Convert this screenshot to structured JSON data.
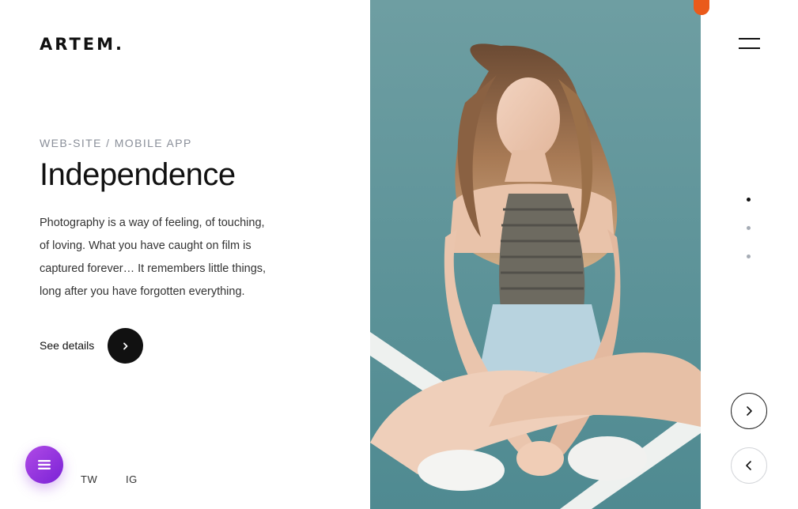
{
  "brand": {
    "logo_text": "ARTEM."
  },
  "project": {
    "category": "WEB-SITE / MOBILE APP",
    "title": "Independence",
    "description": "Photography is a way of feeling, of touching, of loving. What you have caught on film is captured forever… It remembers little things, long after you have forgotten everything.",
    "details_label": "See details"
  },
  "social": {
    "links": [
      "TW",
      "IG"
    ]
  },
  "slider": {
    "total_slides": 3,
    "active_index": 0
  },
  "icons": {
    "details": "chevron-right-icon",
    "menu": "hamburger-icon",
    "fab": "menu-lines-icon",
    "next": "chevron-right-icon",
    "prev": "chevron-left-icon"
  },
  "colors": {
    "accent_orange": "#ea5a1b",
    "fab_gradient_start": "#b04ae6",
    "fab_gradient_end": "#7a22d6",
    "text_dark": "#111111",
    "text_muted": "#8a8f99"
  }
}
